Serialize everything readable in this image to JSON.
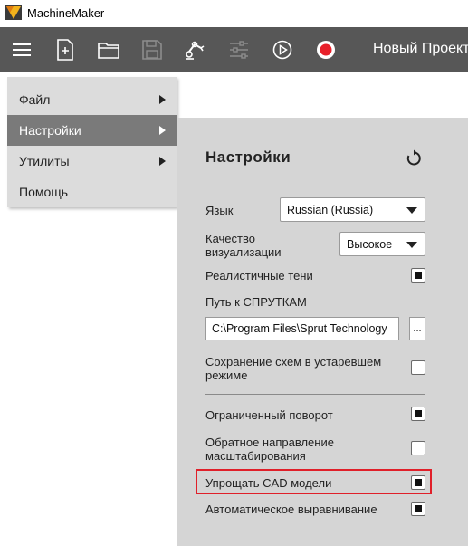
{
  "window": {
    "title": "MachineMaker"
  },
  "toolbar": {
    "buttons": [
      "menu-icon",
      "new-file-icon",
      "open-folder-icon",
      "save-icon",
      "robot-arm-icon",
      "sliders-icon",
      "play-icon",
      "record-icon"
    ],
    "project_title": "Новый Проект"
  },
  "menu": {
    "items": [
      {
        "label": "Файл",
        "has_submenu": true
      },
      {
        "label": "Настройки",
        "has_submenu": true,
        "active": true
      },
      {
        "label": "Утилиты",
        "has_submenu": true
      },
      {
        "label": "Помощь",
        "has_submenu": false
      }
    ]
  },
  "settings": {
    "title": "Настройки",
    "language_label": "Язык",
    "language_value": "Russian (Russia)",
    "quality_label_1": "Качество",
    "quality_label_2": "визуализации",
    "quality_value": "Высокое",
    "shadows_label": "Реалистичные тени",
    "shadows_checked": true,
    "path_label": "Путь к СПРУТКАМ",
    "path_value": "C:\\Program Files\\Sprut Technology",
    "browse_label": "...",
    "legacy_label_1": "Сохранение схем в устаревшем",
    "legacy_label_2": "режиме",
    "legacy_checked": false,
    "limited_rotation_label": "Ограниченный поворот",
    "limited_rotation_checked": true,
    "reverse_zoom_label_1": "Обратное направление",
    "reverse_zoom_label_2": "масштабирования",
    "reverse_zoom_checked": false,
    "simplify_cad_label": "Упрощать CAD модели",
    "simplify_cad_checked": true,
    "auto_align_label": "Автоматическое выравнивание",
    "auto_align_checked": true
  },
  "colors": {
    "toolbar_bg": "#575757",
    "menu_bg": "#dcdcdc",
    "menu_active_bg": "#7a7a7a",
    "panel_bg": "#d5d5d5",
    "highlight": "#e0202a",
    "record_red": "#e8202a"
  }
}
